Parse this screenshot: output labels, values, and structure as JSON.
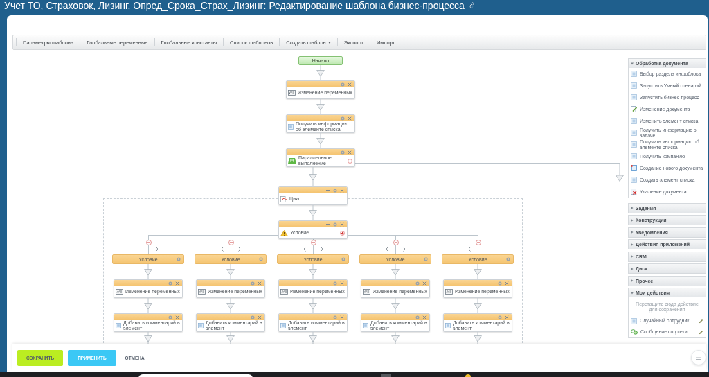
{
  "title": "Учет ТО, Страховок, Лизинг. Опред_Срока_Страх_Лизинг: Редактирование шаблона бизнес-процесса",
  "toolbar": [
    {
      "label": "Параметры шаблона",
      "dropdown": false
    },
    {
      "label": "Глобальные переменные",
      "dropdown": false
    },
    {
      "label": "Глобальные константы",
      "dropdown": false
    },
    {
      "label": "Список шаблонов",
      "dropdown": false
    },
    {
      "label": "Создать шаблон",
      "dropdown": true
    },
    {
      "label": "Экспорт",
      "dropdown": false
    },
    {
      "label": "Импорт",
      "dropdown": false
    }
  ],
  "diagram": {
    "start": "Начало",
    "steps": [
      {
        "kind": "variables",
        "label": "Изменение переменных"
      },
      {
        "kind": "document",
        "label": "Получить информацию об элементе списка"
      },
      {
        "kind": "parallel",
        "label": "Параллельное выполнение"
      },
      {
        "kind": "loop",
        "label": "Цикл",
        "children": [
          {
            "kind": "condition",
            "label": "Условие",
            "branches": [
              {
                "label": "Условие",
                "steps": [
                  {
                    "kind": "variables",
                    "label": "Изменение переменных"
                  },
                  {
                    "kind": "document",
                    "label": "Добавить комментарий в элемент"
                  }
                ]
              },
              {
                "label": "Условие",
                "steps": [
                  {
                    "kind": "variables",
                    "label": "Изменение переменных"
                  },
                  {
                    "kind": "document",
                    "label": "Добавить комментарий в элемент"
                  }
                ]
              },
              {
                "label": "Условие",
                "steps": [
                  {
                    "kind": "variables",
                    "label": "Изменение переменных"
                  },
                  {
                    "kind": "document",
                    "label": "Добавить комментарий в элемент"
                  }
                ]
              },
              {
                "label": "Условие",
                "steps": [
                  {
                    "kind": "variables",
                    "label": "Изменение переменных"
                  },
                  {
                    "kind": "document",
                    "label": "Добавить комментарий в элемент"
                  }
                ]
              },
              {
                "label": "Условие",
                "steps": [
                  {
                    "kind": "variables",
                    "label": "Изменение переменных"
                  },
                  {
                    "kind": "document",
                    "label": "Добавить комментарий в элемент"
                  }
                ]
              }
            ]
          }
        ]
      }
    ]
  },
  "palette": {
    "sections": [
      {
        "title": "Обработка документа",
        "expanded": true,
        "items": [
          {
            "kind": "block",
            "label": "Выбор раздела инфоблока"
          },
          {
            "kind": "block",
            "label": "Запустить Умный сценарий"
          },
          {
            "kind": "block",
            "label": "Запустить бизнес-процесс"
          },
          {
            "kind": "edit",
            "label": "Изменение документа"
          },
          {
            "kind": "block",
            "label": "Изменить элемент списка"
          },
          {
            "kind": "block",
            "label": "Получить информацию о задаче"
          },
          {
            "kind": "block",
            "label": "Получить информацию об элементе списка"
          },
          {
            "kind": "block",
            "label": "Получить компанию"
          },
          {
            "kind": "create",
            "label": "Создание нового документа"
          },
          {
            "kind": "block",
            "label": "Создать элемент списка"
          },
          {
            "kind": "delete",
            "label": "Удаление документа"
          }
        ]
      },
      {
        "title": "Задания",
        "expanded": false
      },
      {
        "title": "Конструкции",
        "expanded": false
      },
      {
        "title": "Уведомления",
        "expanded": false
      },
      {
        "title": "Действия приложений",
        "expanded": false
      },
      {
        "title": "CRM",
        "expanded": false
      },
      {
        "title": "Диск",
        "expanded": false
      },
      {
        "title": "Прочее",
        "expanded": false
      },
      {
        "title": "Мои действия",
        "expanded": true,
        "editable": true,
        "drop_hint": "Перетащите сюда действие для сохранения",
        "items": [
          {
            "kind": "block",
            "label": "Случайный сотрудник"
          },
          {
            "kind": "message",
            "label": "Сообщение соц.сети"
          }
        ]
      }
    ]
  },
  "footer": {
    "buttons": [
      {
        "kind": "save",
        "label": "СОХРАНИТЬ"
      },
      {
        "kind": "apply",
        "label": "ПРИМЕНИТЬ"
      },
      {
        "kind": "cancel",
        "label": "ОТМЕНА"
      }
    ]
  }
}
